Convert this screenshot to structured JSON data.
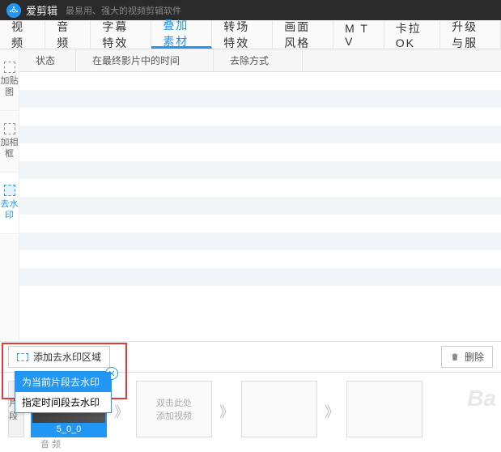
{
  "header": {
    "app_name": "爱剪辑",
    "tagline": "最易用、强大的视频剪辑软件"
  },
  "main_tabs": [
    "视 频",
    "音 频",
    "字幕特效",
    "叠加素材",
    "转场特效",
    "画面风格",
    "M T V",
    "卡拉OK",
    "升级与服"
  ],
  "active_main_tab": 3,
  "side_tools": [
    {
      "label": "加贴图"
    },
    {
      "label": "加相框"
    },
    {
      "label": "去水印"
    }
  ],
  "active_side_tool": 2,
  "columns": [
    "状态",
    "在最终影片中的时间",
    "去除方式"
  ],
  "actions": {
    "add_region": "添加去水印区域",
    "delete": "删除"
  },
  "popup": {
    "opt1": "为当前片段去水印",
    "opt2": "指定时间段去水印"
  },
  "timeline": {
    "rail": "片段",
    "clip_label": "5_0_0",
    "slot_line1": "双击此处",
    "slot_line2": "添加视频",
    "footer": "音 频"
  },
  "watermark": "Ba"
}
